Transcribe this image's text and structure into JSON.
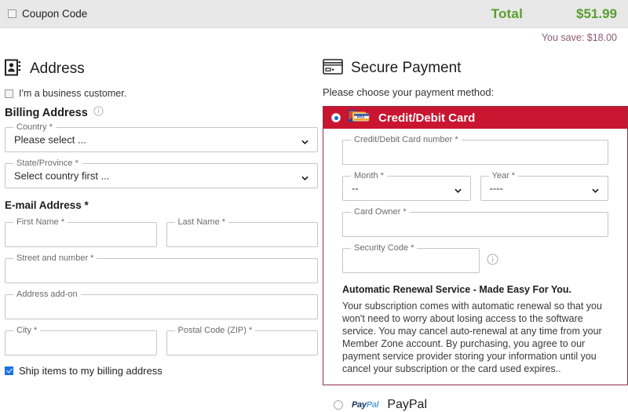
{
  "topbar": {
    "coupon_label": "Coupon Code",
    "coupon_checkbox_icon": "checkbox-unchecked-icon",
    "total_label": "Total",
    "total_value": "$51.99",
    "savings_text": "You save: $18.00",
    "total_color": "#5a9e2f",
    "savings_color": "#8e5a73",
    "bar_color": "#e8e8e8"
  },
  "address": {
    "icon": "address-book-icon",
    "title": "Address",
    "business_customer": {
      "icon": "checkbox-unchecked-icon",
      "label": "I'm a business customer."
    },
    "billing_heading": "Billing Address",
    "billing_info_icon": "info-circle-icon",
    "fields": {
      "country": {
        "label": "Country *",
        "value": "Please select ...",
        "icon": "chevron-down-icon"
      },
      "state": {
        "label": "State/Province *",
        "value": "Select country first ...",
        "icon": "chevron-down-icon"
      },
      "email_heading": "E-mail Address *",
      "first_name": {
        "label": "First Name *",
        "value": ""
      },
      "last_name": {
        "label": "Last Name *",
        "value": ""
      },
      "street": {
        "label": "Street and number *",
        "value": ""
      },
      "address_addon": {
        "label": "Address add-on",
        "value": ""
      },
      "city": {
        "label": "City *",
        "value": ""
      },
      "postal": {
        "label": "Postal Code (ZIP) *",
        "value": ""
      }
    },
    "ship_same": {
      "icon": "checkbox-checked-icon",
      "label": "Ship items to my billing address",
      "color": "#1a73e8"
    }
  },
  "payment": {
    "icon": "credit-card-icon",
    "title": "Secure Payment",
    "choose_text": "Please choose your payment method:",
    "methods": [
      {
        "id": "credit-debit-card",
        "label": "Credit/Debit Card",
        "selected": true,
        "header_color": "#c9152f",
        "border_color": "#8d3148",
        "brand_icon": "card-brands-icon",
        "radio_icon": "radio-selected-icon"
      },
      {
        "id": "paypal",
        "label": "PayPal",
        "selected": false,
        "logo_part_one": "Pay",
        "logo_part_two": "Pal",
        "radio_icon": "radio-unselected-icon"
      }
    ],
    "card_fields": {
      "number": {
        "label": "Credit/Debit Card number *",
        "value": ""
      },
      "month": {
        "label": "Month *",
        "value": "--",
        "icon": "chevron-down-icon"
      },
      "year": {
        "label": "Year *",
        "value": "----",
        "icon": "chevron-down-icon"
      },
      "owner": {
        "label": "Card Owner *",
        "value": ""
      },
      "security_code": {
        "label": "Security Code *",
        "value": "",
        "info_icon": "info-circle-icon"
      }
    },
    "renewal": {
      "title": "Automatic Renewal Service - Made Easy For You.",
      "body": "Your subscription comes with automatic renewal so that you won't need to worry about losing access to the software service. You may cancel auto-renewal at any time from your Member Zone account. By purchasing, you agree to our payment service provider storing your information until you cancel your subscription or the card used expires.."
    }
  }
}
